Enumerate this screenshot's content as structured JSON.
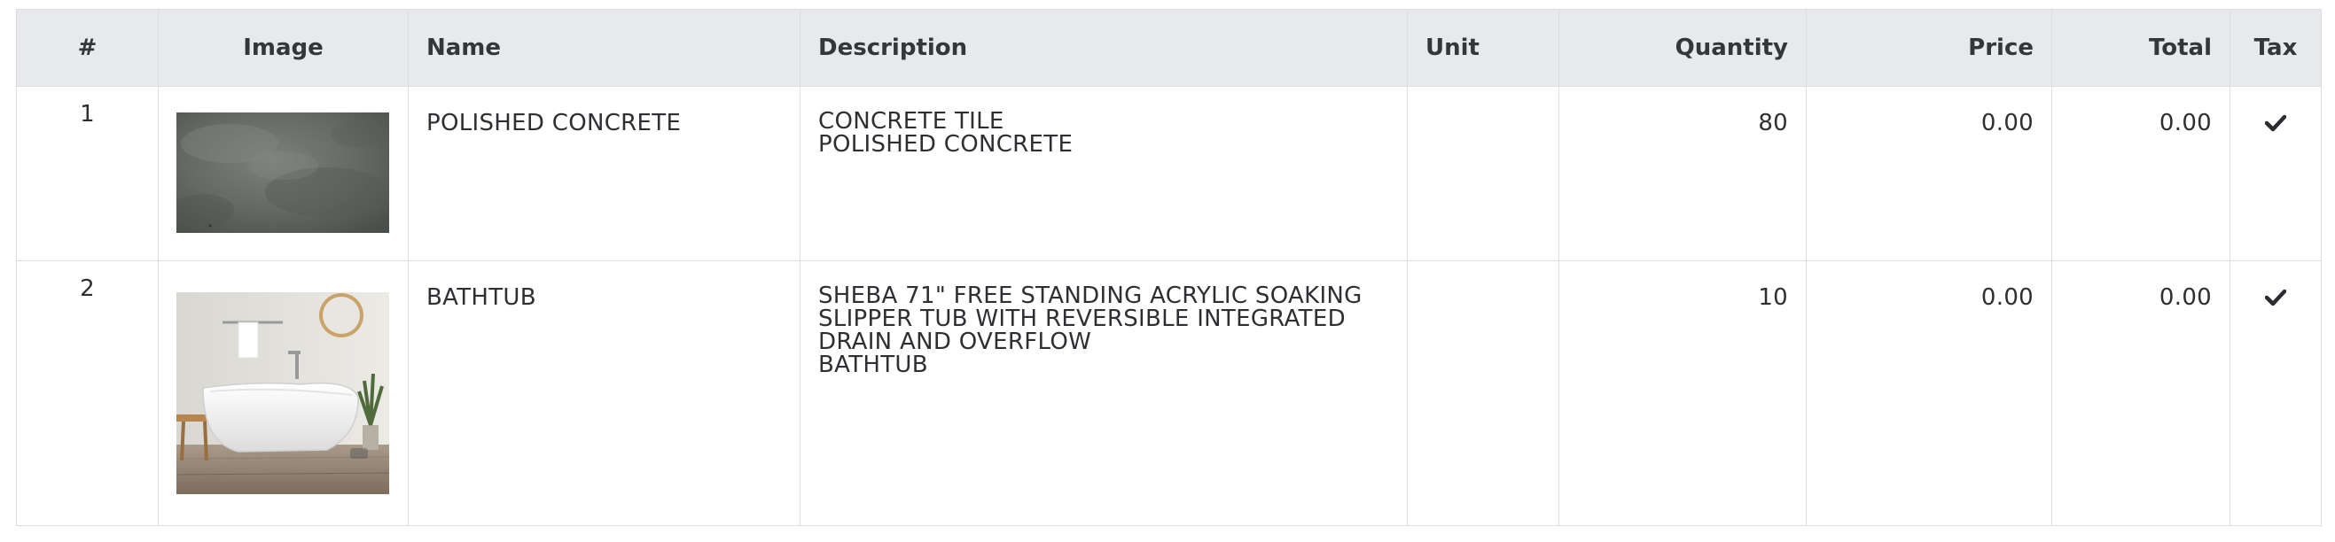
{
  "table": {
    "headers": {
      "number": "#",
      "image": "Image",
      "name": "Name",
      "description": "Description",
      "unit": "Unit",
      "quantity": "Quantity",
      "price": "Price",
      "total": "Total",
      "tax": "Tax"
    },
    "rows": [
      {
        "number": "1",
        "image_icon": "concrete-tile-thumbnail",
        "name": "POLISHED CONCRETE",
        "description": [
          "CONCRETE TILE",
          "POLISHED CONCRETE"
        ],
        "unit": "",
        "quantity": "80",
        "price": "0.00",
        "total": "0.00",
        "tax_icon": "check-icon"
      },
      {
        "number": "2",
        "image_icon": "bathtub-thumbnail",
        "name": "BATHTUB",
        "description": [
          "SHEBA 71\" FREE STANDING ACRYLIC SOAKING",
          "SLIPPER TUB WITH REVERSIBLE INTEGRATED",
          "DRAIN AND OVERFLOW",
          "BATHTUB"
        ],
        "unit": "",
        "quantity": "10",
        "price": "0.00",
        "total": "0.00",
        "tax_icon": "check-icon"
      }
    ]
  }
}
